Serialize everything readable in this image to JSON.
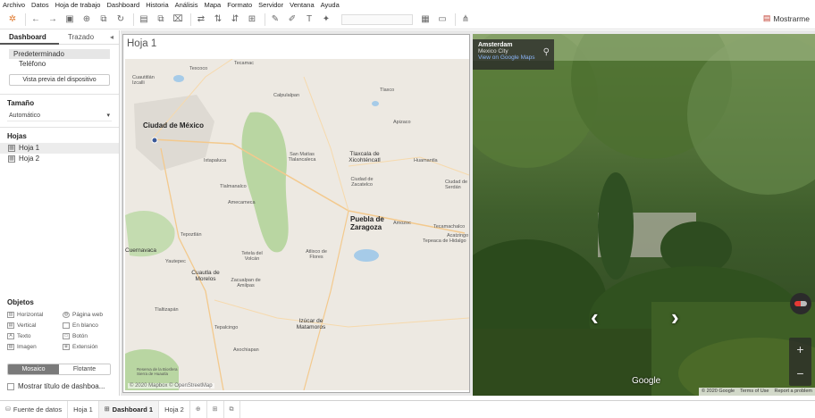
{
  "menu": [
    "Archivo",
    "Datos",
    "Hoja de trabajo",
    "Dashboard",
    "Historia",
    "Análisis",
    "Mapa",
    "Formato",
    "Servidor",
    "Ventana",
    "Ayuda"
  ],
  "toolbar": {
    "icons": [
      "tableau-logo-icon",
      "undo-icon",
      "redo-icon",
      "save-icon",
      "new-datasource-icon",
      "pause-icon",
      "new-sheet-icon",
      "duplicate-icon",
      "clear-icon",
      "swap-icon",
      "sort-asc-icon",
      "sort-desc-icon",
      "group-icon",
      "highlight-icon",
      "label-icon",
      "pin-icon",
      "fit-icon",
      "presentation-icon",
      "share-icon"
    ],
    "present_label": "Mostrarme"
  },
  "left": {
    "tab_dashboard": "Dashboard",
    "tab_layout": "Trazado",
    "devices": [
      "Predeterminado",
      "Teléfono"
    ],
    "preview_button": "Vista previa del dispositivo",
    "size_title": "Tamaño",
    "size_value": "Automático",
    "sheets_title": "Hojas",
    "sheets": [
      "Hoja 1",
      "Hoja 2"
    ],
    "objects_title": "Objetos",
    "objects": [
      "Horizontal",
      "Página web",
      "Vertical",
      "En blanco",
      "Texto",
      "Botón",
      "Imagen",
      "Extensión"
    ],
    "tiled_label": "Mosaico",
    "floating_label": "Flotante",
    "show_title_label": "Mostrar título de dashboa..."
  },
  "sheet": {
    "title": "Hoja 1",
    "map_credit": "© 2020 Mapbox © OpenStreetMap",
    "map_labels": [
      {
        "text": "Ciudad de México",
        "cls": "big"
      },
      {
        "text": "Puebla de Zaragoza",
        "cls": "big"
      },
      {
        "text": "Tlaxcala de Xicohténcatl",
        "cls": "med"
      },
      {
        "text": "Cuautla de Morelos",
        "cls": "med"
      },
      {
        "text": "Izúcar de Matamoros",
        "cls": "med"
      },
      {
        "text": "Cuernavaca",
        "cls": "med"
      },
      {
        "text": "Texcoco",
        "cls": ""
      },
      {
        "text": "Calpulalpan",
        "cls": ""
      },
      {
        "text": "Tlaxco",
        "cls": ""
      },
      {
        "text": "Apizaco",
        "cls": ""
      },
      {
        "text": "Huamantla",
        "cls": ""
      },
      {
        "text": "Tecamac",
        "cls": ""
      },
      {
        "text": "Cuautitlán Izcalli",
        "cls": ""
      },
      {
        "text": "Ixtapaluca",
        "cls": ""
      },
      {
        "text": "Tlalmanalco",
        "cls": ""
      },
      {
        "text": "Amecameca",
        "cls": ""
      },
      {
        "text": "San Matías Tlalancaleca",
        "cls": ""
      },
      {
        "text": "Ciudad de Zacatelco",
        "cls": ""
      },
      {
        "text": "Amozoc",
        "cls": ""
      },
      {
        "text": "Acatzingo",
        "cls": ""
      },
      {
        "text": "Tepeaca de Hidalgo",
        "cls": ""
      },
      {
        "text": "Tepoztlán",
        "cls": ""
      },
      {
        "text": "Yautepec",
        "cls": ""
      },
      {
        "text": "Tetela del Volcán",
        "cls": ""
      },
      {
        "text": "Atlixco de Flores",
        "cls": ""
      },
      {
        "text": "Zacualpan de Amilpas",
        "cls": ""
      },
      {
        "text": "Tlaltizapán",
        "cls": ""
      },
      {
        "text": "Tepalcingo",
        "cls": ""
      },
      {
        "text": "Axochiapan",
        "cls": ""
      },
      {
        "text": "Ciudad de Serdán",
        "cls": ""
      },
      {
        "text": "Tecamachalco",
        "cls": ""
      },
      {
        "text": "Reserva de la Biosfera Sierra de Huautla",
        "cls": ""
      }
    ]
  },
  "street": {
    "place": "Amsterdam",
    "city": "Mexico City",
    "link": "View on Google Maps",
    "google_logo": "Google",
    "footer": [
      "© 2020 Google",
      "Terms of Use",
      "Report a problem"
    ]
  },
  "bottom": {
    "datasource": "Fuente de datos",
    "tabs": [
      "Hoja 1",
      "Dashboard 1",
      "Hoja 2"
    ]
  }
}
